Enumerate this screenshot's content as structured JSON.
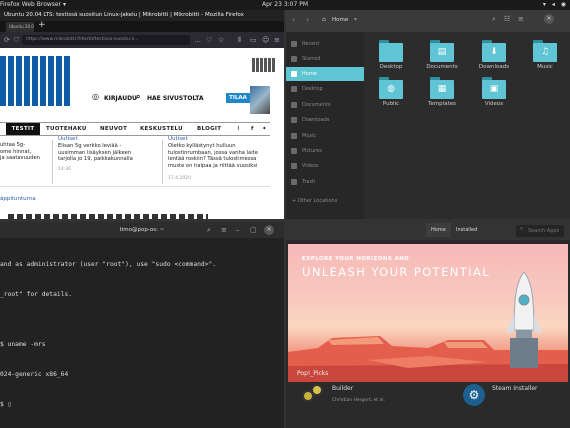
{
  "topbar": {
    "app": "Firefox Web Browser ▾",
    "clock": "Apr 23  3:07 PM",
    "tray": "▾ ◂ ◉"
  },
  "firefox": {
    "title": "Ubuntu 20.04 LTS: testissä suositun Linux-jakelu | Mikrobitti | Mikrobitti - Mozilla Firefox",
    "tab_label": "Ubuntu 20.04 LTS: testissä suos...",
    "url": "https://www.mikrobitti.fi/testit/testissa-suositu-li...",
    "site": {
      "kirjaudu": "KIRJAUDU",
      "hae": "HAE SIVUSTOLTA",
      "tilaa": "TILAA",
      "menu": [
        "TESTIT",
        "TUOTEHAKU",
        "NEUVOT",
        "KESKUSTELU",
        "BLOGIT"
      ],
      "articles": [
        {
          "tag": "",
          "text": "uhtaa 5g-\nome hinnat,\nja saatavuuden",
          "time": ""
        },
        {
          "tag": "Uutiset",
          "text": "Elisan 5g verkko leviää -\nuusimman lisäyksen jälkeen\ntarjolla jo 19. paikkakunnalla",
          "time": "14:36"
        },
        {
          "tag": "Uutiset",
          "text": "Oletko kyllästynyt hulluun\ntulostinrumbaan, jossa vanha laite\nlentää roskiin? Tässä tulostimessa\nmuste on halpaa ja riittää vuosiksi",
          "time": "17.4.2020"
        }
      ],
      "link": "äppitunturna"
    }
  },
  "files": {
    "location": "Home",
    "sidebar": [
      "Recent",
      "Starred",
      "Home",
      "Desktop",
      "Documents",
      "Downloads",
      "Music",
      "Pictures",
      "Videos",
      "Trash",
      "+ Other Locations"
    ],
    "active": "Home",
    "folders": [
      {
        "name": "Desktop",
        "icon": ""
      },
      {
        "name": "Documents",
        "icon": "▤"
      },
      {
        "name": "Downloads",
        "icon": "⬇"
      },
      {
        "name": "Music",
        "icon": "♫"
      },
      {
        "name": "Public",
        "icon": "◍"
      },
      {
        "name": "Templates",
        "icon": "▦"
      },
      {
        "name": "Videos",
        "icon": "▣"
      }
    ]
  },
  "terminal": {
    "title": "timo@pop-os: ~",
    "lines": [
      "and as administrator (user \"root\"), use \"sudo <command>\".",
      "_root\" for details.",
      "",
      "$ uname -mrs",
      "024-generic x86_64",
      "$ ▯"
    ]
  },
  "store": {
    "tabs": [
      "Home",
      "Installed"
    ],
    "search_placeholder": "Search Apps",
    "banner_small": "EXPLORE YOUR HORIZONS AND",
    "banner_big": "UNLEASH YOUR POTENTIAL",
    "section": "Pop!_Picks",
    "apps": [
      {
        "name": "Builder",
        "sub": "Christian Hergert, et al."
      },
      {
        "name": "Steam Installer",
        "sub": ""
      }
    ]
  }
}
